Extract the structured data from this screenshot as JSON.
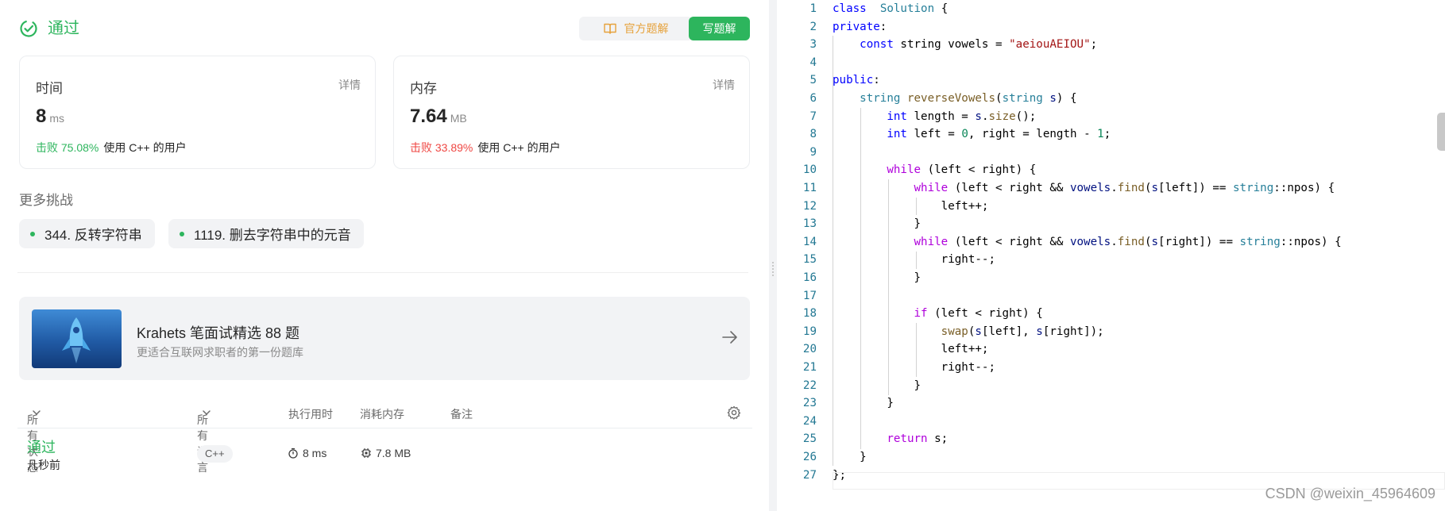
{
  "result": {
    "status": "通过",
    "official_solution_label": "官方题解",
    "write_solution_label": "写题解"
  },
  "stats": {
    "time": {
      "label": "时间",
      "detail": "详情",
      "value": "8",
      "unit": "ms",
      "beat": "击败 75.08%",
      "beat_suffix": "使用 C++ 的用户",
      "beat_color": "#2db55d"
    },
    "memory": {
      "label": "内存",
      "detail": "详情",
      "value": "7.64",
      "unit": "MB",
      "beat": "击败 33.89%",
      "beat_suffix": "使用 C++ 的用户",
      "beat_color": "#ef4743"
    }
  },
  "more": {
    "title": "更多挑战",
    "items": [
      {
        "label": "344. 反转字符串"
      },
      {
        "label": "1119. 删去字符串中的元音"
      }
    ]
  },
  "promo": {
    "title": "Krahets 笔面试精选 88 题",
    "subtitle": "更适合互联网求职者的第一份题库"
  },
  "table": {
    "headers": {
      "status": "所有状态",
      "language": "所有语言",
      "runtime": "执行用时",
      "memory": "消耗内存",
      "notes": "备注"
    },
    "rows": [
      {
        "status": "通过",
        "when": "几秒前",
        "language": "C++",
        "runtime": "8 ms",
        "memory": "7.8 MB"
      }
    ]
  },
  "code": {
    "lines": [
      [
        [
          "kw",
          "class"
        ],
        [
          "",
          "  "
        ],
        [
          "ty",
          "Solution"
        ],
        [
          "",
          " {"
        ]
      ],
      [
        [
          "kw",
          "private"
        ],
        [
          "",
          ":"
        ]
      ],
      [
        [
          "",
          "    "
        ],
        [
          "kw",
          "const"
        ],
        [
          "",
          " string vowels = "
        ],
        [
          "st",
          "\"aeiouAEIOU\""
        ],
        [
          "",
          ";"
        ]
      ],
      [],
      [
        [
          "kw",
          "public"
        ],
        [
          "",
          ":"
        ]
      ],
      [
        [
          "",
          "    "
        ],
        [
          "ty",
          "string"
        ],
        [
          "",
          ""
        ],
        [
          "fn",
          " reverseVowels"
        ],
        [
          "",
          "("
        ],
        [
          "ty",
          "string"
        ],
        [
          "",
          " "
        ],
        [
          "var",
          "s"
        ],
        [
          "",
          ") {"
        ]
      ],
      [
        [
          "",
          "        "
        ],
        [
          "kw",
          "int"
        ],
        [
          "",
          " length = "
        ],
        [
          "var",
          "s"
        ],
        [
          "",
          "."
        ],
        [
          "fn",
          "size"
        ],
        [
          "",
          "();"
        ]
      ],
      [
        [
          "",
          "        "
        ],
        [
          "kw",
          "int"
        ],
        [
          "",
          " left = "
        ],
        [
          "nu",
          "0"
        ],
        [
          "",
          ", right = length - "
        ],
        [
          "nu",
          "1"
        ],
        [
          "",
          ";"
        ]
      ],
      [],
      [
        [
          "",
          "        "
        ],
        [
          "ct",
          "while"
        ],
        [
          "",
          " (left < right) {"
        ]
      ],
      [
        [
          "",
          "            "
        ],
        [
          "ct",
          "while"
        ],
        [
          "",
          " (left < right && "
        ],
        [
          "var",
          "vowels"
        ],
        [
          "",
          "."
        ],
        [
          "fn",
          "find"
        ],
        [
          "",
          "("
        ],
        [
          "var",
          "s"
        ],
        [
          "",
          "[left]) == "
        ],
        [
          "ty",
          "string"
        ],
        [
          "",
          "::npos) {"
        ]
      ],
      [
        [
          "",
          "                left++;"
        ]
      ],
      [
        [
          "",
          "            }"
        ]
      ],
      [
        [
          "",
          "            "
        ],
        [
          "ct",
          "while"
        ],
        [
          "",
          " (left < right && "
        ],
        [
          "var",
          "vowels"
        ],
        [
          "",
          "."
        ],
        [
          "fn",
          "find"
        ],
        [
          "",
          "("
        ],
        [
          "var",
          "s"
        ],
        [
          "",
          "[right]) == "
        ],
        [
          "ty",
          "string"
        ],
        [
          "",
          "::npos) {"
        ]
      ],
      [
        [
          "",
          "                right--;"
        ]
      ],
      [
        [
          "",
          "            }"
        ]
      ],
      [],
      [
        [
          "",
          "            "
        ],
        [
          "ct",
          "if"
        ],
        [
          "",
          " (left < right) {"
        ]
      ],
      [
        [
          "",
          "                "
        ],
        [
          "fn",
          "swap"
        ],
        [
          "",
          "("
        ],
        [
          "var",
          "s"
        ],
        [
          "",
          "[left], "
        ],
        [
          "var",
          "s"
        ],
        [
          "",
          "[right]);"
        ]
      ],
      [
        [
          "",
          "                left++;"
        ]
      ],
      [
        [
          "",
          "                right--;"
        ]
      ],
      [
        [
          "",
          "            }"
        ]
      ],
      [
        [
          "",
          "        }"
        ]
      ],
      [],
      [
        [
          "",
          "        "
        ],
        [
          "ct",
          "return"
        ],
        [
          "",
          " s;"
        ]
      ],
      [
        [
          "",
          "    }"
        ]
      ],
      [
        [
          "",
          "};"
        ]
      ]
    ]
  },
  "watermark": "CSDN @weixin_45964609",
  "colors": {
    "accent": "#2db55d",
    "warn": "#ef4743",
    "gold": "#e6a23c"
  }
}
